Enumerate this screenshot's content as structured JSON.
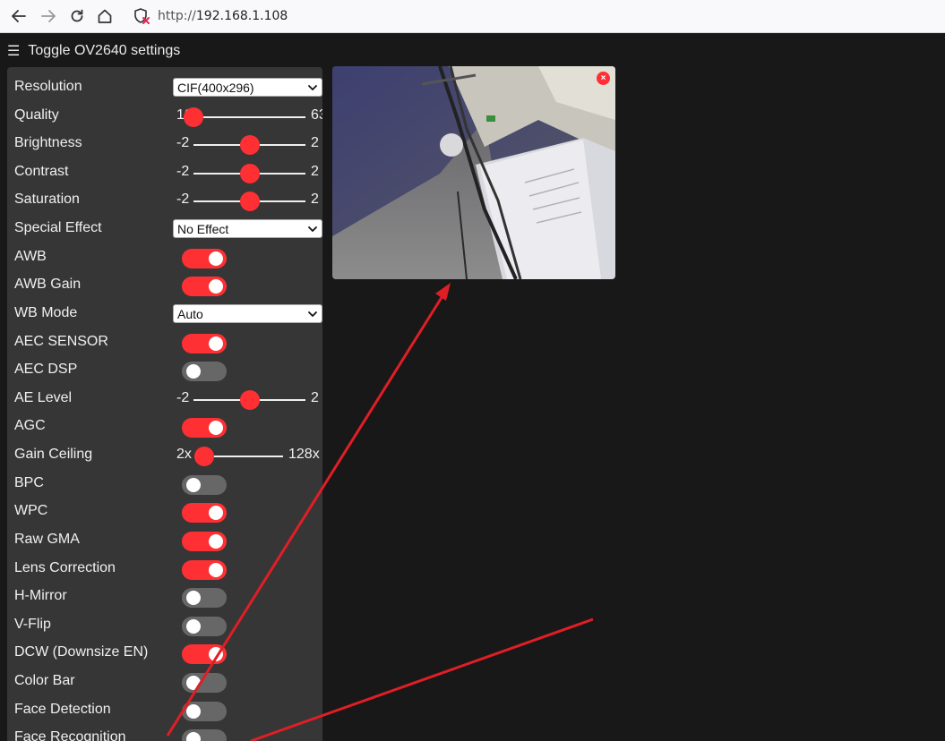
{
  "browser": {
    "url_prefix": "http://",
    "url_host": "192.168.1.108",
    "icons": [
      "back-icon",
      "forward-icon",
      "reload-icon",
      "home-icon",
      "insecure-shield-icon"
    ]
  },
  "menu": {
    "toggle_icon": "☰",
    "toggle_label": "Toggle OV2640 settings"
  },
  "settings": [
    {
      "type": "select",
      "label": "Resolution",
      "value": "CIF(400x296)"
    },
    {
      "type": "range",
      "label": "Quality",
      "min": "10",
      "max": "63",
      "value": 10
    },
    {
      "type": "range",
      "label": "Brightness",
      "min": "-2",
      "max": "2",
      "value": 0
    },
    {
      "type": "range",
      "label": "Contrast",
      "min": "-2",
      "max": "2",
      "value": 0
    },
    {
      "type": "range",
      "label": "Saturation",
      "min": "-2",
      "max": "2",
      "value": 0
    },
    {
      "type": "select",
      "label": "Special Effect",
      "value": "No Effect"
    },
    {
      "type": "toggle",
      "label": "AWB",
      "on": true
    },
    {
      "type": "toggle",
      "label": "AWB Gain",
      "on": true
    },
    {
      "type": "select",
      "label": "WB Mode",
      "value": "Auto"
    },
    {
      "type": "toggle",
      "label": "AEC SENSOR",
      "on": true
    },
    {
      "type": "toggle",
      "label": "AEC DSP",
      "on": false
    },
    {
      "type": "range",
      "label": "AE Level",
      "min": "-2",
      "max": "2",
      "value": 0
    },
    {
      "type": "toggle",
      "label": "AGC",
      "on": true
    },
    {
      "type": "range",
      "label": "Gain Ceiling",
      "min": "2x",
      "max": "128x",
      "value": 0
    },
    {
      "type": "toggle",
      "label": "BPC",
      "on": false
    },
    {
      "type": "toggle",
      "label": "WPC",
      "on": true
    },
    {
      "type": "toggle",
      "label": "Raw GMA",
      "on": true
    },
    {
      "type": "toggle",
      "label": "Lens Correction",
      "on": true
    },
    {
      "type": "toggle",
      "label": "H-Mirror",
      "on": false
    },
    {
      "type": "toggle",
      "label": "V-Flip",
      "on": false
    },
    {
      "type": "toggle",
      "label": "DCW (Downsize EN)",
      "on": true
    },
    {
      "type": "toggle",
      "label": "Color Bar",
      "on": false
    },
    {
      "type": "toggle",
      "label": "Face Detection",
      "on": false
    },
    {
      "type": "toggle",
      "label": "Face Recognition",
      "on": false
    }
  ],
  "stream": {
    "close_label": "×"
  },
  "colors": {
    "accent": "#ff3034",
    "panel": "#363636",
    "background": "#181818",
    "toggle_off": "#676767"
  }
}
